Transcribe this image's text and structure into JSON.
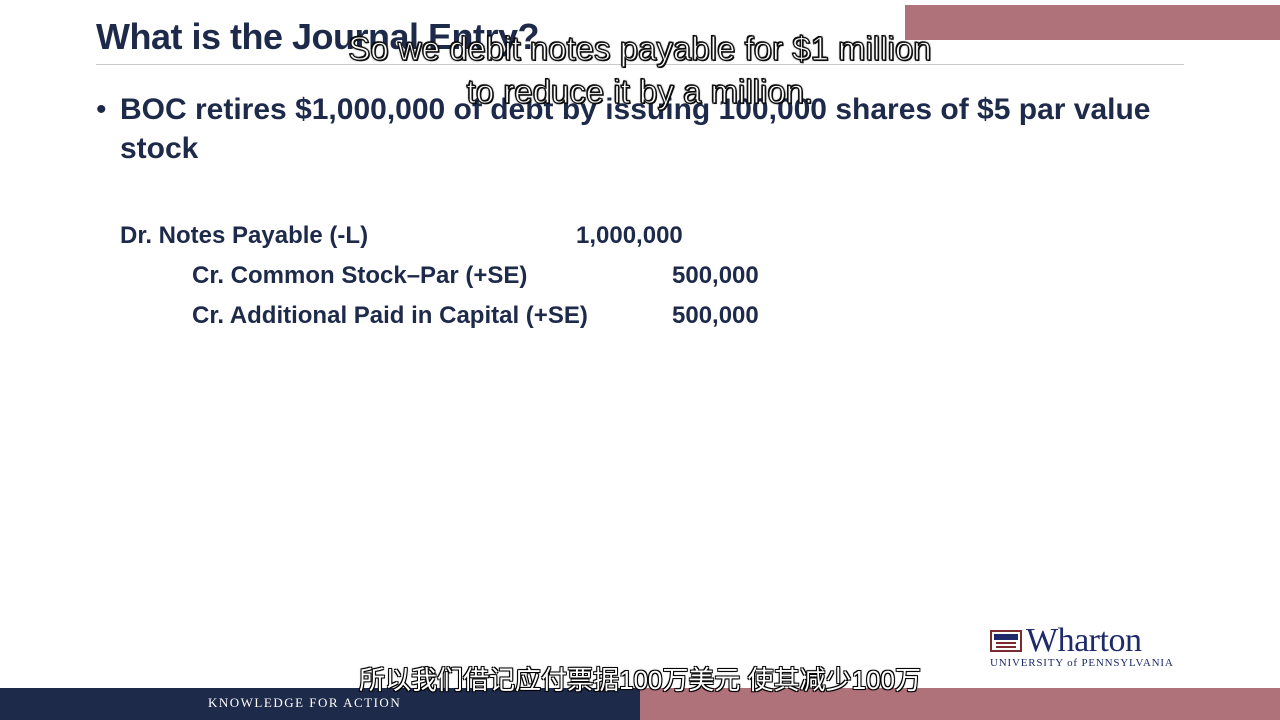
{
  "slide": {
    "title": "What is the Journal Entry?",
    "bullet": "BOC retires $1,000,000 of debt by issuing 100,000 shares of $5 par value stock",
    "bullet_marker": "•"
  },
  "journal_entry": [
    {
      "label": "Dr. Notes Payable (-L)",
      "amount": "1,000,000"
    },
    {
      "label": "Cr.  Common Stock–Par (+SE)",
      "amount": "500,000"
    },
    {
      "label": "Cr.  Additional Paid in Capital (+SE)",
      "amount": "500,000"
    }
  ],
  "captions": {
    "english": "So we debit notes payable for $1 million to reduce it by a million.",
    "chinese": "所以我们借记应付票据100万美元 使其减少100万"
  },
  "logo": {
    "name": "Wharton",
    "subtitle": "UNIVERSITY of PENNSYLVANIA"
  },
  "footer": {
    "tagline": "KNOWLEDGE FOR ACTION"
  },
  "colors": {
    "navy": "#1e2a4a",
    "rose": "#b0727a"
  }
}
